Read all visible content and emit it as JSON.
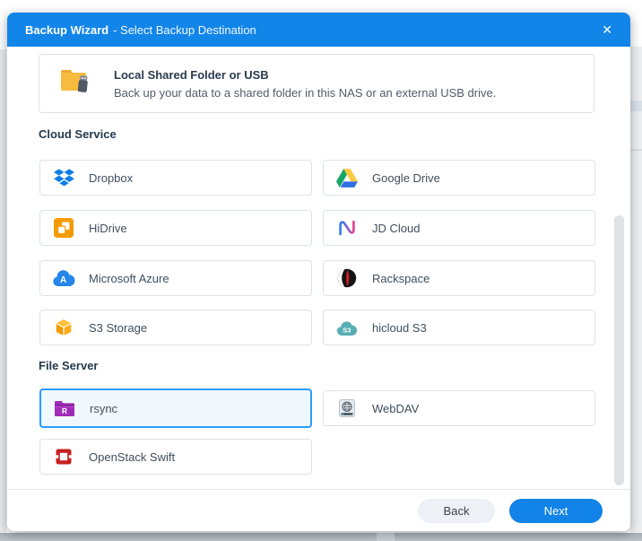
{
  "titlebar": {
    "title_bold": "Backup Wizard",
    "title_rest": "- Select Backup Destination",
    "close": "✕"
  },
  "local_option": {
    "title": "Local Shared Folder or USB",
    "description": "Back up your data to a shared folder in this NAS or an external USB drive."
  },
  "sections": {
    "cloud": {
      "heading": "Cloud Service"
    },
    "file_server": {
      "heading": "File Server"
    }
  },
  "options": {
    "dropbox": {
      "label": "Dropbox"
    },
    "google_drive": {
      "label": "Google Drive"
    },
    "hidrive": {
      "label": "HiDrive"
    },
    "jd_cloud": {
      "label": "JD Cloud"
    },
    "azure": {
      "label": "Microsoft Azure",
      "icon_letter": "A"
    },
    "rackspace": {
      "label": "Rackspace"
    },
    "s3": {
      "label": "S3 Storage"
    },
    "hicloud": {
      "label": "hicloud S3",
      "icon_text": "S3"
    },
    "rsync": {
      "label": "rsync",
      "selected": true,
      "icon_letter": "R"
    },
    "webdav": {
      "label": "WebDAV"
    },
    "openstack": {
      "label": "OpenStack Swift"
    }
  },
  "footer": {
    "back": "Back",
    "next": "Next"
  },
  "colors": {
    "titlebar_blue": "#1285E9",
    "accent_blue": "#1283E8",
    "selected_border": "#2B9CFF",
    "selected_bg": "#F0F8FE"
  }
}
